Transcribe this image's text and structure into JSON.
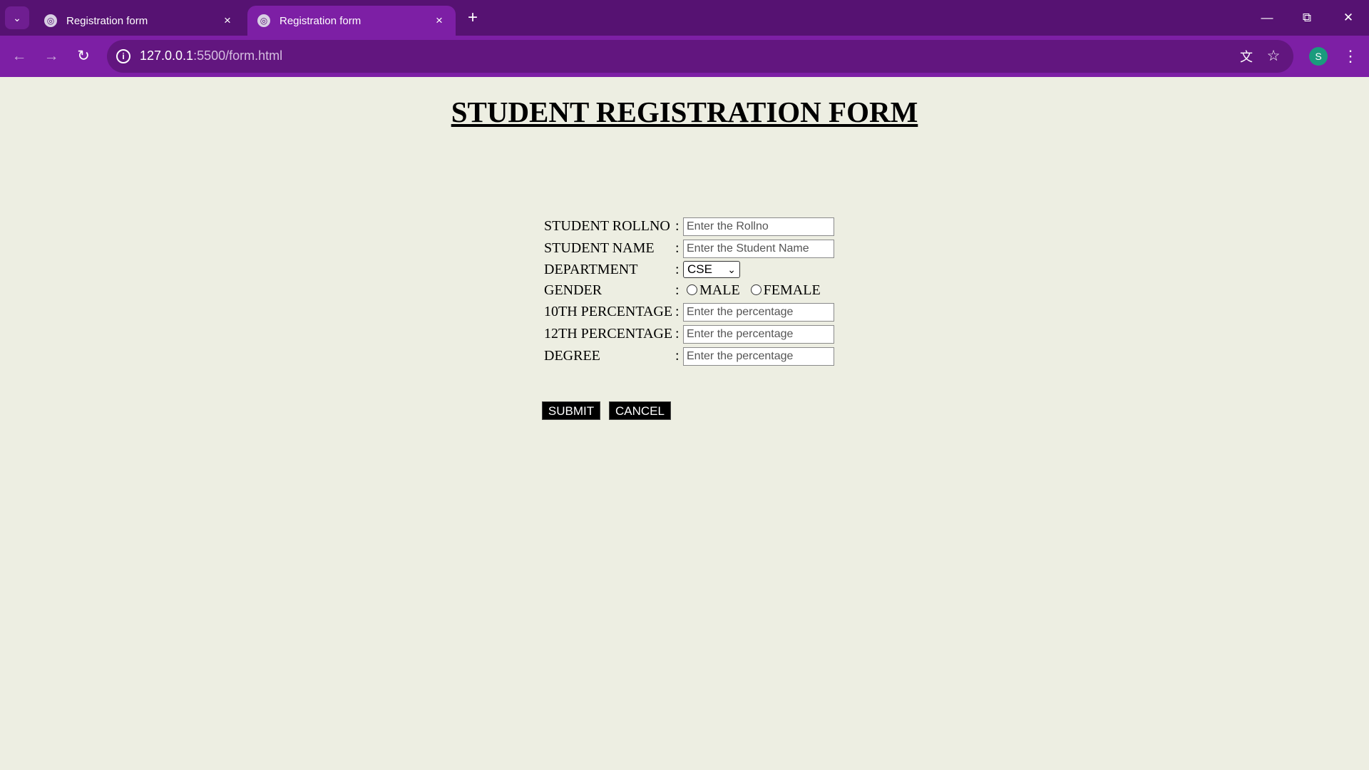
{
  "browser": {
    "tabs": [
      {
        "title": "Registration form",
        "close_icon": "×"
      },
      {
        "title": "Registration form",
        "close_icon": "×"
      }
    ],
    "new_tab_icon": "+",
    "url_host": "127.0.0.1",
    "url_path": ":5500/form.html",
    "profile_initial": "S",
    "accent_color": "#7d1fa5"
  },
  "page": {
    "title": "STUDENT REGISTRATION FORM",
    "background_color": "#edeee2"
  },
  "form": {
    "colon": ":",
    "fields": [
      {
        "label": "STUDENT ROLLNO",
        "placeholder": "Enter the Rollno"
      },
      {
        "label": "STUDENT NAME",
        "placeholder": "Enter the Student Name"
      },
      {
        "label": "DEPARTMENT",
        "selected": "CSE"
      },
      {
        "label": "GENDER",
        "options": [
          "MALE",
          "FEMALE"
        ]
      },
      {
        "label": "10TH PERCENTAGE",
        "placeholder": "Enter the percentage"
      },
      {
        "label": "12TH PERCENTAGE",
        "placeholder": "Enter the percentage"
      },
      {
        "label": "DEGREE",
        "placeholder": "Enter the percentage"
      }
    ],
    "submit_label": "SUBMIT",
    "cancel_label": "CANCEL"
  }
}
